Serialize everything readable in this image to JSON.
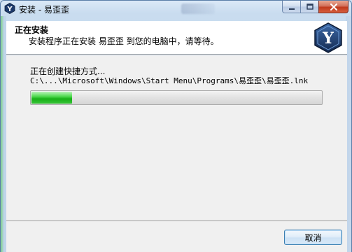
{
  "window": {
    "title": "安装 - 易歪歪"
  },
  "caption": {
    "minimize_icon": "minimize-icon",
    "maximize_icon": "maximize-icon",
    "close_icon": "close-icon"
  },
  "header": {
    "title": "正在安装",
    "subtitle": "安装程序正在安装 易歪歪 到您的电脑中，请等待。",
    "logo_letter": "Y"
  },
  "main": {
    "status": "正在创建快捷方式...",
    "path": "C:\\...\\Microsoft\\Windows\\Start Menu\\Programs\\易歪歪\\易歪歪.lnk",
    "progress_percent": 14
  },
  "footer": {
    "cancel_label": "取消"
  },
  "colors": {
    "progress_green": "#18b018",
    "close_red": "#c0391d",
    "logo_bg": "#1f3f74"
  }
}
